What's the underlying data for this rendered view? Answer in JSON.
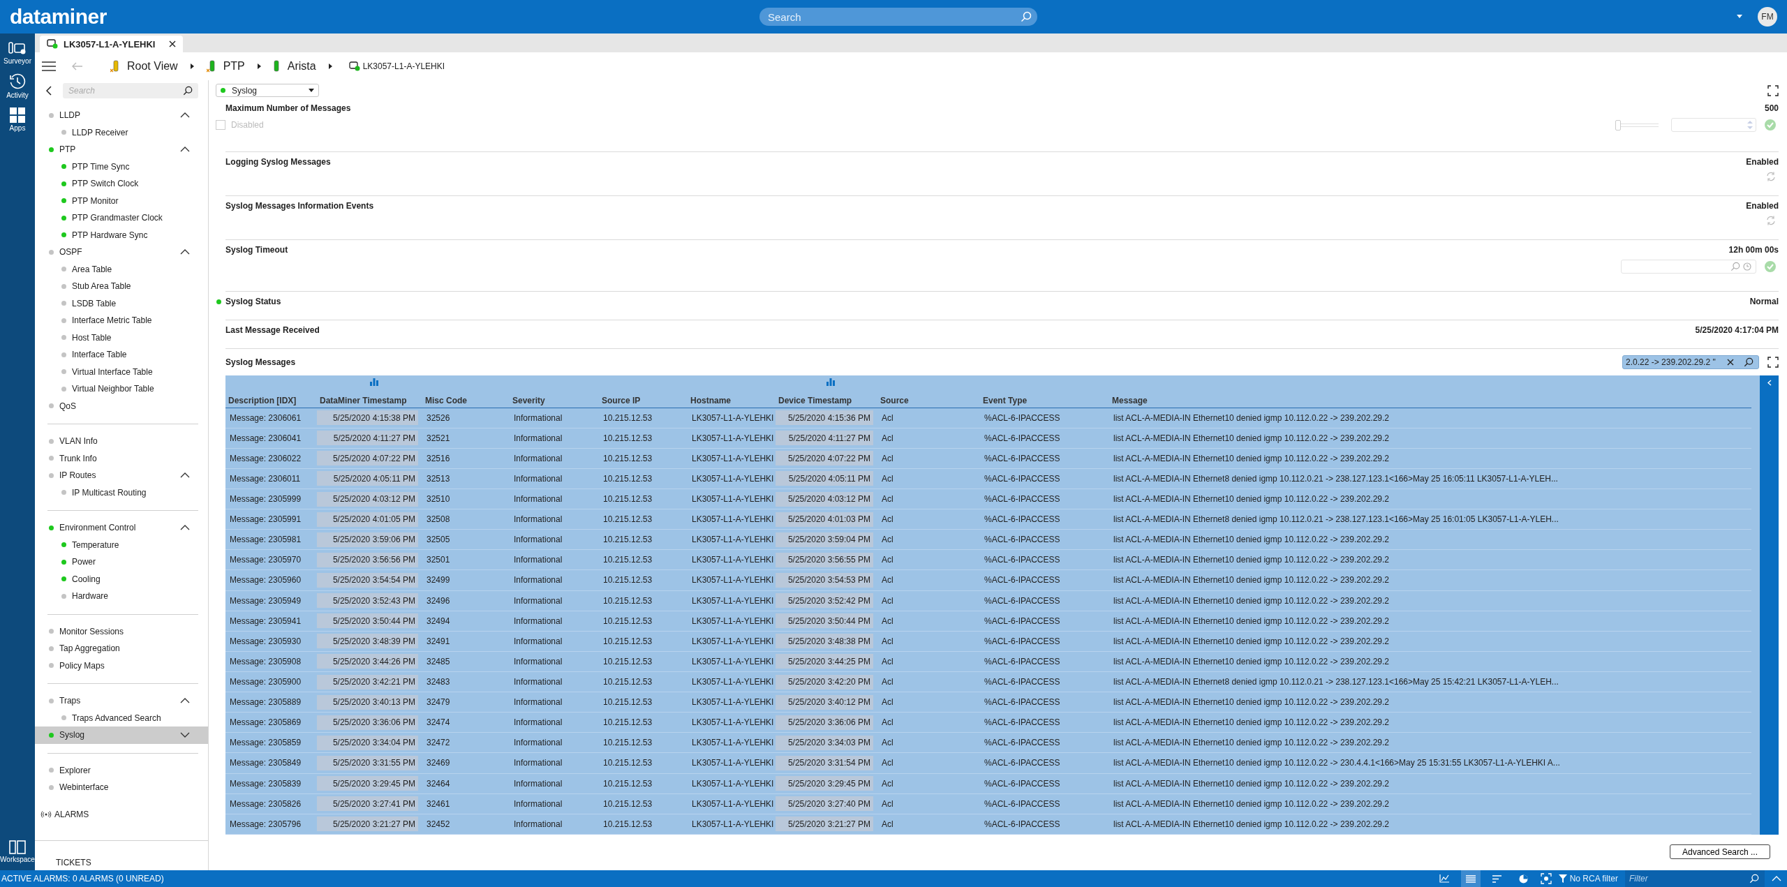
{
  "app": {
    "logo": "dataminer",
    "search_placeholder": "Search",
    "user_initials": "FM"
  },
  "rail": {
    "top": [
      {
        "label": "Surveyor",
        "kind": "surveyor"
      },
      {
        "label": "Activity",
        "kind": "activity"
      },
      {
        "label": "Apps",
        "kind": "apps"
      }
    ],
    "bottom": [
      {
        "label": "Workspace",
        "kind": "workspace"
      }
    ]
  },
  "tabs": [
    {
      "label": "LK3057-L1-A-YLEHKI",
      "selected": true
    }
  ],
  "breadcrumb": [
    {
      "label": "Root View",
      "kind": "view",
      "color": "#e6b800"
    },
    {
      "label": "PTP",
      "kind": "view",
      "color": "#1eb41e"
    },
    {
      "label": "Arista",
      "kind": "group",
      "color": "#1eb41e"
    },
    {
      "label": "LK3057-L1-A-YLEHKI",
      "kind": "element",
      "color": "#1eb41e"
    }
  ],
  "sidebar": {
    "search_placeholder": "Search",
    "sections": [
      [
        {
          "label": "LLDP",
          "color": "#c4c4c4",
          "selected": false,
          "expanded": true,
          "children": [
            {
              "label": "LLDP Receiver",
              "color": "#c4c4c4",
              "selected": false
            }
          ]
        },
        {
          "label": "PTP",
          "color": "#1ec81e",
          "selected": false,
          "expanded": true,
          "children": [
            {
              "label": "PTP Time Sync",
              "color": "#1ec81e",
              "selected": false
            },
            {
              "label": "PTP Switch Clock",
              "color": "#1ec81e",
              "selected": false
            },
            {
              "label": "PTP Monitor",
              "color": "#1ec81e",
              "selected": false
            },
            {
              "label": "PTP Grandmaster Clock",
              "color": "#1ec81e",
              "selected": false
            },
            {
              "label": "PTP Hardware Sync",
              "color": "#1ec81e",
              "selected": false
            }
          ]
        },
        {
          "label": "OSPF",
          "color": "#c4c4c4",
          "selected": false,
          "expanded": true,
          "children": [
            {
              "label": "Area Table",
              "color": "#c4c4c4",
              "selected": false
            },
            {
              "label": "Stub Area Table",
              "color": "#c4c4c4",
              "selected": false
            },
            {
              "label": "LSDB Table",
              "color": "#c4c4c4",
              "selected": false
            },
            {
              "label": "Interface Metric Table",
              "color": "#c4c4c4",
              "selected": false
            },
            {
              "label": "Host Table",
              "color": "#c4c4c4",
              "selected": false
            },
            {
              "label": "Interface Table",
              "color": "#c4c4c4",
              "selected": false
            },
            {
              "label": "Virtual Interface Table",
              "color": "#c4c4c4",
              "selected": false
            },
            {
              "label": "Virtual Neighbor Table",
              "color": "#c4c4c4",
              "selected": false
            }
          ]
        },
        {
          "label": "QoS",
          "color": "#c4c4c4",
          "selected": false
        }
      ],
      [
        {
          "label": "VLAN Info",
          "color": "#c4c4c4",
          "selected": false
        },
        {
          "label": "Trunk Info",
          "color": "#c4c4c4",
          "selected": false
        },
        {
          "label": "IP Routes",
          "color": "#c4c4c4",
          "selected": false,
          "expanded": true,
          "children": [
            {
              "label": "IP Multicast Routing",
              "color": "#c4c4c4",
              "selected": false
            }
          ]
        }
      ],
      [
        {
          "label": "Environment Control",
          "color": "#1ec81e",
          "selected": false,
          "expanded": true,
          "children": [
            {
              "label": "Temperature",
              "color": "#1ec81e",
              "selected": false
            },
            {
              "label": "Power",
              "color": "#1ec81e",
              "selected": false
            },
            {
              "label": "Cooling",
              "color": "#1ec81e",
              "selected": false
            },
            {
              "label": "Hardware",
              "color": "#c4c4c4",
              "selected": false
            }
          ]
        }
      ],
      [
        {
          "label": "Monitor Sessions",
          "color": "#c4c4c4",
          "selected": false
        },
        {
          "label": "Tap Aggregation",
          "color": "#c4c4c4",
          "selected": false
        },
        {
          "label": "Policy Maps",
          "color": "#c4c4c4",
          "selected": false
        }
      ],
      [
        {
          "label": "Traps",
          "color": "#c4c4c4",
          "selected": false,
          "expanded": true,
          "children": [
            {
              "label": "Traps Advanced Search",
              "color": "#c4c4c4",
              "selected": false
            }
          ]
        },
        {
          "label": "Syslog",
          "color": "#1ec81e",
          "selected": true,
          "expanded": false
        }
      ],
      [
        {
          "label": "Explorer",
          "color": "#c4c4c4",
          "selected": false
        },
        {
          "label": "Webinterface",
          "color": "#c4c4c4",
          "selected": false
        }
      ]
    ],
    "footer": [
      {
        "label": "ALARMS",
        "kind": "alarms"
      },
      {
        "label": "TICKETS",
        "kind": "tickets"
      }
    ]
  },
  "main": {
    "selector": {
      "label": "Syslog",
      "color": "#1ec81e"
    },
    "params": [
      {
        "label": "Maximum Number of Messages",
        "value": "500",
        "kind": "number",
        "option": {
          "label": "Disabled",
          "checked": false
        },
        "level": 0
      },
      {
        "label": "Logging Syslog Messages",
        "value": "Enabled",
        "kind": "toggle"
      },
      {
        "label": "Syslog Messages Information Events",
        "value": "Enabled",
        "kind": "toggle"
      },
      {
        "label": "Syslog Timeout",
        "value": "12h 00m 00s",
        "kind": "time"
      },
      {
        "label": "Syslog Status",
        "value": "Normal",
        "kind": "status",
        "color": "#1ec81e"
      },
      {
        "label": "Last Message Received",
        "value": "5/25/2020 4:17:04 PM",
        "kind": "readonly"
      }
    ],
    "table": {
      "title": "Syslog Messages",
      "filter_value": "2.0.22 -> 239.202.29.2 \"",
      "columns": [
        {
          "label": "Description [IDX]",
          "kind": "text",
          "trend": false
        },
        {
          "label": "DataMiner Timestamp",
          "kind": "timestamp",
          "trend": true
        },
        {
          "label": "Misc Code",
          "kind": "text",
          "trend": false
        },
        {
          "label": "Severity",
          "kind": "text",
          "trend": false
        },
        {
          "label": "Source IP",
          "kind": "text",
          "trend": false
        },
        {
          "label": "Hostname",
          "kind": "text",
          "trend": false
        },
        {
          "label": "Device Timestamp",
          "kind": "timestamp",
          "trend": true
        },
        {
          "label": "Source",
          "kind": "text",
          "trend": false
        },
        {
          "label": "Event Type",
          "kind": "text",
          "trend": false
        },
        {
          "label": "Message",
          "kind": "text",
          "trend": false
        }
      ],
      "rows": [
        [
          "Message: 2306061",
          "5/25/2020 4:15:38 PM",
          "32526",
          "Informational",
          "10.215.12.53",
          "LK3057-L1-A-YLEHKI",
          "5/25/2020 4:15:36 PM",
          "Acl",
          "%ACL-6-IPACCESS",
          "list ACL-A-MEDIA-IN Ethernet10 denied igmp 10.112.0.22 -> 239.202.29.2"
        ],
        [
          "Message: 2306041",
          "5/25/2020 4:11:27 PM",
          "32521",
          "Informational",
          "10.215.12.53",
          "LK3057-L1-A-YLEHKI",
          "5/25/2020 4:11:27 PM",
          "Acl",
          "%ACL-6-IPACCESS",
          "list ACL-A-MEDIA-IN Ethernet10 denied igmp 10.112.0.22 -> 239.202.29.2"
        ],
        [
          "Message: 2306022",
          "5/25/2020 4:07:22 PM",
          "32516",
          "Informational",
          "10.215.12.53",
          "LK3057-L1-A-YLEHKI",
          "5/25/2020 4:07:22 PM",
          "Acl",
          "%ACL-6-IPACCESS",
          "list ACL-A-MEDIA-IN Ethernet10 denied igmp 10.112.0.22 -> 239.202.29.2"
        ],
        [
          "Message: 2306011",
          "5/25/2020 4:05:11 PM",
          "32513",
          "Informational",
          "10.215.12.53",
          "LK3057-L1-A-YLEHKI",
          "5/25/2020 4:05:11 PM",
          "Acl",
          "%ACL-6-IPACCESS",
          "list ACL-A-MEDIA-IN Ethernet8 denied igmp 10.112.0.21 -> 238.127.123.1<166>May 25 16:05:11 LK3057-L1-A-YLEH..."
        ],
        [
          "Message: 2305999",
          "5/25/2020 4:03:12 PM",
          "32510",
          "Informational",
          "10.215.12.53",
          "LK3057-L1-A-YLEHKI",
          "5/25/2020 4:03:12 PM",
          "Acl",
          "%ACL-6-IPACCESS",
          "list ACL-A-MEDIA-IN Ethernet10 denied igmp 10.112.0.22 -> 239.202.29.2"
        ],
        [
          "Message: 2305991",
          "5/25/2020 4:01:05 PM",
          "32508",
          "Informational",
          "10.215.12.53",
          "LK3057-L1-A-YLEHKI",
          "5/25/2020 4:01:03 PM",
          "Acl",
          "%ACL-6-IPACCESS",
          "list ACL-A-MEDIA-IN Ethernet8 denied igmp 10.112.0.21 -> 238.127.123.1<166>May 25 16:01:05 LK3057-L1-A-YLEH..."
        ],
        [
          "Message: 2305981",
          "5/25/2020 3:59:06 PM",
          "32505",
          "Informational",
          "10.215.12.53",
          "LK3057-L1-A-YLEHKI",
          "5/25/2020 3:59:04 PM",
          "Acl",
          "%ACL-6-IPACCESS",
          "list ACL-A-MEDIA-IN Ethernet10 denied igmp 10.112.0.22 -> 239.202.29.2"
        ],
        [
          "Message: 2305970",
          "5/25/2020 3:56:56 PM",
          "32501",
          "Informational",
          "10.215.12.53",
          "LK3057-L1-A-YLEHKI",
          "5/25/2020 3:56:55 PM",
          "Acl",
          "%ACL-6-IPACCESS",
          "list ACL-A-MEDIA-IN Ethernet10 denied igmp 10.112.0.22 -> 239.202.29.2"
        ],
        [
          "Message: 2305960",
          "5/25/2020 3:54:54 PM",
          "32499",
          "Informational",
          "10.215.12.53",
          "LK3057-L1-A-YLEHKI",
          "5/25/2020 3:54:53 PM",
          "Acl",
          "%ACL-6-IPACCESS",
          "list ACL-A-MEDIA-IN Ethernet10 denied igmp 10.112.0.22 -> 239.202.29.2"
        ],
        [
          "Message: 2305949",
          "5/25/2020 3:52:43 PM",
          "32496",
          "Informational",
          "10.215.12.53",
          "LK3057-L1-A-YLEHKI",
          "5/25/2020 3:52:42 PM",
          "Acl",
          "%ACL-6-IPACCESS",
          "list ACL-A-MEDIA-IN Ethernet10 denied igmp 10.112.0.22 -> 239.202.29.2"
        ],
        [
          "Message: 2305941",
          "5/25/2020 3:50:44 PM",
          "32494",
          "Informational",
          "10.215.12.53",
          "LK3057-L1-A-YLEHKI",
          "5/25/2020 3:50:44 PM",
          "Acl",
          "%ACL-6-IPACCESS",
          "list ACL-A-MEDIA-IN Ethernet10 denied igmp 10.112.0.22 -> 239.202.29.2"
        ],
        [
          "Message: 2305930",
          "5/25/2020 3:48:39 PM",
          "32491",
          "Informational",
          "10.215.12.53",
          "LK3057-L1-A-YLEHKI",
          "5/25/2020 3:48:38 PM",
          "Acl",
          "%ACL-6-IPACCESS",
          "list ACL-A-MEDIA-IN Ethernet10 denied igmp 10.112.0.22 -> 239.202.29.2"
        ],
        [
          "Message: 2305908",
          "5/25/2020 3:44:26 PM",
          "32485",
          "Informational",
          "10.215.12.53",
          "LK3057-L1-A-YLEHKI",
          "5/25/2020 3:44:25 PM",
          "Acl",
          "%ACL-6-IPACCESS",
          "list ACL-A-MEDIA-IN Ethernet10 denied igmp 10.112.0.22 -> 239.202.29.2"
        ],
        [
          "Message: 2305900",
          "5/25/2020 3:42:21 PM",
          "32483",
          "Informational",
          "10.215.12.53",
          "LK3057-L1-A-YLEHKI",
          "5/25/2020 3:42:20 PM",
          "Acl",
          "%ACL-6-IPACCESS",
          "list ACL-A-MEDIA-IN Ethernet8 denied igmp 10.112.0.21 -> 238.127.123.1<166>May 25 15:42:21 LK3057-L1-A-YLEH..."
        ],
        [
          "Message: 2305889",
          "5/25/2020 3:40:13 PM",
          "32479",
          "Informational",
          "10.215.12.53",
          "LK3057-L1-A-YLEHKI",
          "5/25/2020 3:40:12 PM",
          "Acl",
          "%ACL-6-IPACCESS",
          "list ACL-A-MEDIA-IN Ethernet10 denied igmp 10.112.0.22 -> 239.202.29.2"
        ],
        [
          "Message: 2305869",
          "5/25/2020 3:36:06 PM",
          "32474",
          "Informational",
          "10.215.12.53",
          "LK3057-L1-A-YLEHKI",
          "5/25/2020 3:36:06 PM",
          "Acl",
          "%ACL-6-IPACCESS",
          "list ACL-A-MEDIA-IN Ethernet10 denied igmp 10.112.0.22 -> 239.202.29.2"
        ],
        [
          "Message: 2305859",
          "5/25/2020 3:34:04 PM",
          "32472",
          "Informational",
          "10.215.12.53",
          "LK3057-L1-A-YLEHKI",
          "5/25/2020 3:34:03 PM",
          "Acl",
          "%ACL-6-IPACCESS",
          "list ACL-A-MEDIA-IN Ethernet10 denied igmp 10.112.0.22 -> 239.202.29.2"
        ],
        [
          "Message: 2305849",
          "5/25/2020 3:31:55 PM",
          "32469",
          "Informational",
          "10.215.12.53",
          "LK3057-L1-A-YLEHKI",
          "5/25/2020 3:31:54 PM",
          "Acl",
          "%ACL-6-IPACCESS",
          "list ACL-A-MEDIA-IN Ethernet10 denied igmp 10.112.0.22 -> 230.4.4.1<166>May 25 15:31:55 LK3057-L1-A-YLEHKI A..."
        ],
        [
          "Message: 2305839",
          "5/25/2020 3:29:45 PM",
          "32464",
          "Informational",
          "10.215.12.53",
          "LK3057-L1-A-YLEHKI",
          "5/25/2020 3:29:45 PM",
          "Acl",
          "%ACL-6-IPACCESS",
          "list ACL-A-MEDIA-IN Ethernet10 denied igmp 10.112.0.22 -> 239.202.29.2"
        ],
        [
          "Message: 2305826",
          "5/25/2020 3:27:41 PM",
          "32461",
          "Informational",
          "10.215.12.53",
          "LK3057-L1-A-YLEHKI",
          "5/25/2020 3:27:40 PM",
          "Acl",
          "%ACL-6-IPACCESS",
          "list ACL-A-MEDIA-IN Ethernet10 denied igmp 10.112.0.22 -> 239.202.29.2"
        ],
        [
          "Message: 2305796",
          "5/25/2020 3:21:27 PM",
          "32452",
          "Informational",
          "10.215.12.53",
          "LK3057-L1-A-YLEHKI",
          "5/25/2020 3:21:27 PM",
          "Acl",
          "%ACL-6-IPACCESS",
          "list ACL-A-MEDIA-IN Ethernet10 denied igmp 10.112.0.22 -> 239.202.29.2"
        ]
      ]
    },
    "advanced_button": "Advanced Search ..."
  },
  "status_bar": {
    "alarms_text": "ACTIVE ALARMS: 0 ALARMS (0 UNREAD)",
    "views": [
      {
        "kind": "trend",
        "selected": false
      },
      {
        "kind": "list",
        "selected": true
      },
      {
        "kind": "sort",
        "selected": false
      },
      {
        "kind": "pie",
        "selected": false
      }
    ],
    "rca_label": "No RCA filter",
    "filter_placeholder": "Filter"
  }
}
